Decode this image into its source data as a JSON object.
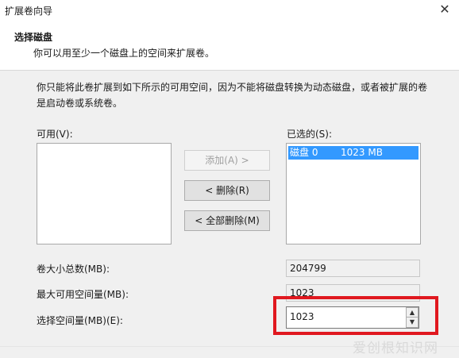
{
  "window": {
    "title": "扩展卷向导",
    "close_glyph": "✕"
  },
  "header": {
    "title": "选择磁盘",
    "subtitle": "你可以用至少一个磁盘上的空间来扩展卷。"
  },
  "description": "你只能将此卷扩展到如下所示的可用空间，因为不能将磁盘转换为动态磁盘，或者被扩展的卷是启动卷或系统卷。",
  "available": {
    "label": "可用(V):",
    "items": []
  },
  "selected": {
    "label": "已选的(S):",
    "items": [
      {
        "disk": "磁盘 0",
        "size": "1023 MB"
      }
    ]
  },
  "buttons": {
    "add": "添加(A) >",
    "remove": "< 删除(R)",
    "remove_all": "< 全部删除(M)"
  },
  "fields": {
    "total_label": "卷大小总数(MB):",
    "total_value": "204799",
    "max_label": "最大可用空间量(MB):",
    "max_value": "1023",
    "select_label": "选择空间量(MB)(E):",
    "select_value": "1023"
  },
  "watermark": "爱创根知识网"
}
